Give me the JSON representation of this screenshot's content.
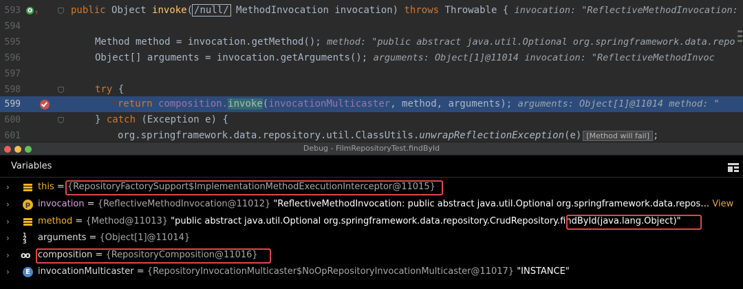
{
  "editor": {
    "lines": [
      {
        "number": "593",
        "tokens": {
          "kw_public": "public",
          "type": "Object",
          "method": "invoke",
          "param_hint": "/null/",
          "param": "MethodInvocation invocation",
          "kw_throws": "throws",
          "exc": "Throwable {",
          "inline": "invocation: \"ReflectiveMethodInvocation:"
        }
      },
      {
        "number": "594"
      },
      {
        "number": "595",
        "tokens": {
          "code": "Method method = invocation.getMethod();",
          "inline": "method: \"public abstract java.util.Optional org.springframework.data.repo"
        }
      },
      {
        "number": "596",
        "tokens": {
          "code": "Object[] arguments = invocation.getArguments();",
          "inline": "arguments: Object[1]@11014",
          "inline2": "invocation: \"ReflectiveMethodInvoc"
        }
      },
      {
        "number": "597"
      },
      {
        "number": "598",
        "tokens": {
          "kw_try": "try",
          "brace": "{"
        }
      },
      {
        "number": "599",
        "tokens": {
          "kw_return": "return",
          "obj": "composition.",
          "call": "invoke",
          "args_open": "(",
          "arg1": "invocationMulticaster",
          "sep1": ", method, arguments);",
          "inline": "arguments: Object[1]@11014",
          "inline2": "method: \""
        }
      },
      {
        "number": "600",
        "tokens": {
          "pre": "} ",
          "kw_catch": "catch",
          "rest": "(Exception e) {"
        }
      },
      {
        "number": "601",
        "tokens": {
          "pre": "org.springframework.data.repository.util.ClassUtils.",
          "static_call": "unwrapReflectionException",
          "post": "(e)",
          "badge": "[Method will fail]",
          "end": ";"
        }
      }
    ]
  },
  "debug_window": {
    "title": "Debug - FilmRepositoryTest.findById",
    "traffic_colors": [
      "#ee5f57",
      "#f5bd4f",
      "#5fc452"
    ]
  },
  "variables_panel": {
    "title": "Variables",
    "rows": [
      {
        "icon": "field-icon",
        "name": "this",
        "eq": " = ",
        "ref": "{RepositoryFactorySupport$ImplementationMethodExecutionInterceptor@11015}",
        "value": ""
      },
      {
        "icon": "parameter-icon",
        "icon_letter": "p",
        "name": "invocation",
        "eq": " = ",
        "ref": "{ReflectiveMethodInvocation@11012}",
        "value": " \"ReflectiveMethodInvocation: public abstract java.util.Optional org.springframework.data.repos…",
        "link": " View"
      },
      {
        "icon": "field-icon",
        "name": "method",
        "eq": " = ",
        "ref": "{Method@11013}",
        "value": " \"public abstract java.util.Optional org.springframework.data.repository.CrudRepository.",
        "value2": "findById(java.lang.Object)\""
      },
      {
        "icon": "array-icon",
        "name": "arguments",
        "eq": " = ",
        "ref": "{Object[1]@11014}",
        "value": ""
      },
      {
        "icon": "watch-icon",
        "name": "composition",
        "eq": " = ",
        "ref": "{RepositoryComposition@11016}",
        "value": ""
      },
      {
        "icon": "enum-icon",
        "icon_letter": "E",
        "name": "invocationMulticaster",
        "eq": " = ",
        "ref": "{RepositoryInvocationMulticaster$NoOpRepositoryInvocationMulticaster@11017}",
        "value": " \"INSTANCE\""
      }
    ]
  }
}
